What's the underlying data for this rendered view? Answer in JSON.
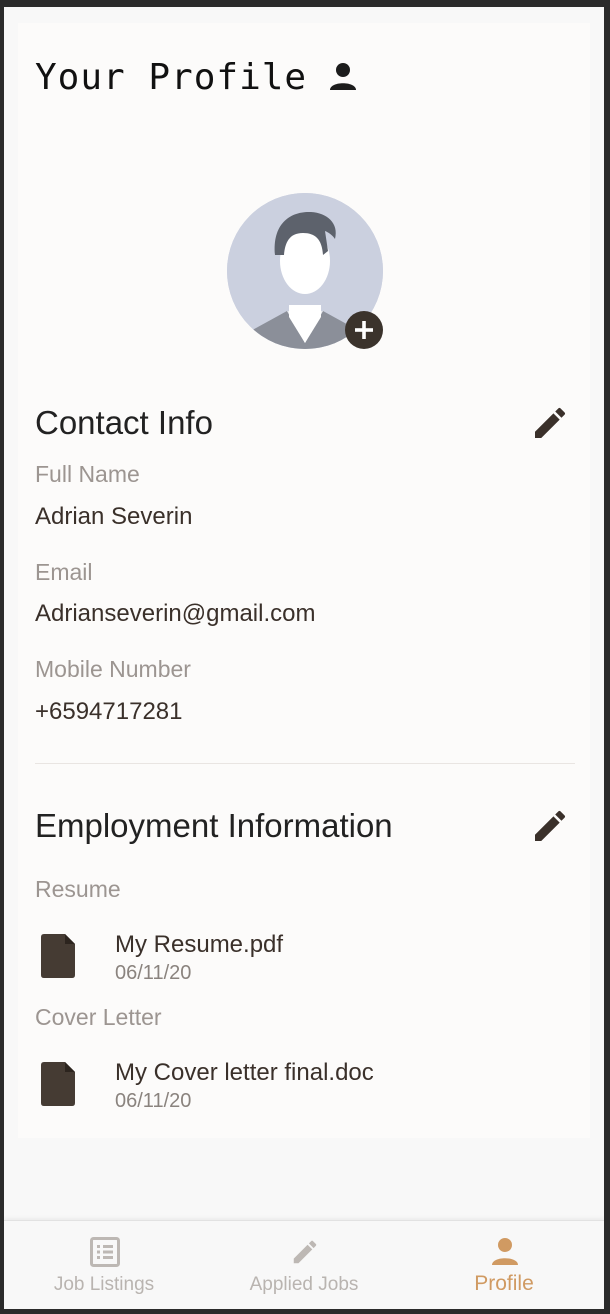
{
  "header": {
    "title": "Your Profile",
    "icon": "person-icon"
  },
  "avatar": {
    "add_icon": "plus-circle-icon"
  },
  "contact": {
    "title": "Contact Info",
    "edit_icon": "pencil-icon",
    "full_name_label": "Full Name",
    "full_name": "Adrian Severin",
    "email_label": "Email",
    "email": "Adrianseverin@gmail.com",
    "mobile_label": "Mobile Number",
    "mobile": "+6594717281"
  },
  "employment": {
    "title": "Employment Information",
    "edit_icon": "pencil-icon",
    "resume_label": "Resume",
    "resume_file": {
      "name": "My Resume.pdf",
      "date": "06/11/20",
      "icon": "document-icon"
    },
    "cover_letter_label": "Cover Letter",
    "cover_letter_file": {
      "name": "My Cover letter final.doc",
      "date": "06/11/20",
      "icon": "document-icon"
    }
  },
  "nav": {
    "items": [
      {
        "label": "Job Listings",
        "icon": "list-icon",
        "active": false
      },
      {
        "label": "Applied Jobs",
        "icon": "pencil-icon",
        "active": false
      },
      {
        "label": "Profile",
        "icon": "person-icon",
        "active": true
      }
    ],
    "active_color": "#d09a62",
    "inactive_color": "#b9b4b0"
  }
}
